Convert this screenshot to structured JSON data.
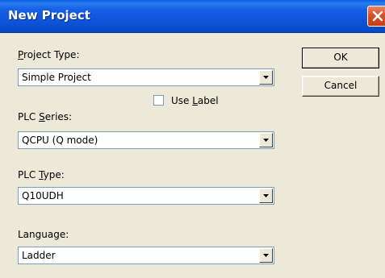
{
  "window": {
    "title": "New Project"
  },
  "fields": {
    "project_type": {
      "label_prefix": "",
      "label_accel": "P",
      "label_suffix": "roject Type:",
      "value": "Simple Project"
    },
    "use_label": {
      "label_prefix": "Use ",
      "label_accel": "L",
      "label_suffix": "abel",
      "checked": false
    },
    "plc_series": {
      "label_prefix": "PLC ",
      "label_accel": "S",
      "label_suffix": "eries:",
      "value": "QCPU (Q mode)"
    },
    "plc_type": {
      "label_prefix": "PLC ",
      "label_accel": "T",
      "label_suffix": "ype:",
      "value": "Q10UDH"
    },
    "language": {
      "label": "Language:",
      "value": "Ladder"
    }
  },
  "buttons": {
    "ok": "OK",
    "cancel": "Cancel"
  },
  "icons": {
    "close": "close-icon",
    "dropdown": "chevron-down-icon"
  },
  "colors": {
    "title_bar": "#0a4fd4",
    "dialog_bg": "#ece9d8",
    "close_button": "#d8502a",
    "field_border": "#7f9db9"
  }
}
